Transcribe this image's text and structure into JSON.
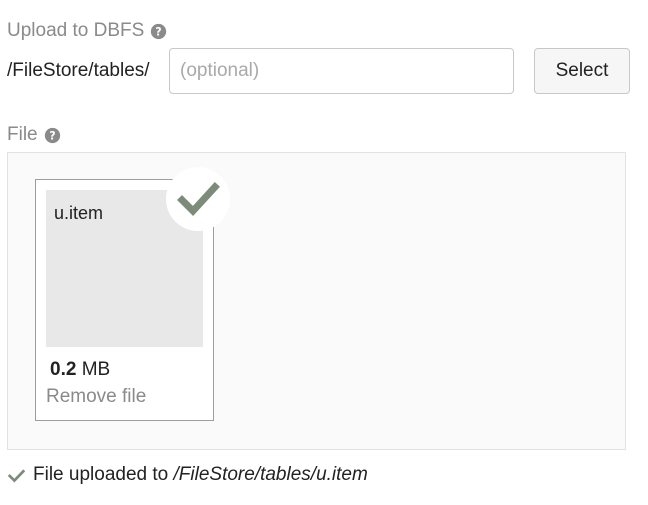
{
  "upload": {
    "label": "Upload to DBFS",
    "path_prefix": "/FileStore/tables/",
    "path_input": {
      "value": "",
      "placeholder": "(optional)"
    },
    "select_label": "Select"
  },
  "file_section": {
    "label": "File"
  },
  "file_card": {
    "name": "u.item",
    "size_value": "0.2",
    "size_unit": "MB",
    "remove_label": "Remove file",
    "status": "uploaded"
  },
  "status": {
    "text": "File uploaded to",
    "path": "/FileStore/tables/u.item"
  },
  "icons": {
    "help": "question-circle-icon",
    "upload_check": "checkmark-icon"
  },
  "colors": {
    "check_green": "#7d8c78",
    "muted_text": "#8a8a8a"
  }
}
